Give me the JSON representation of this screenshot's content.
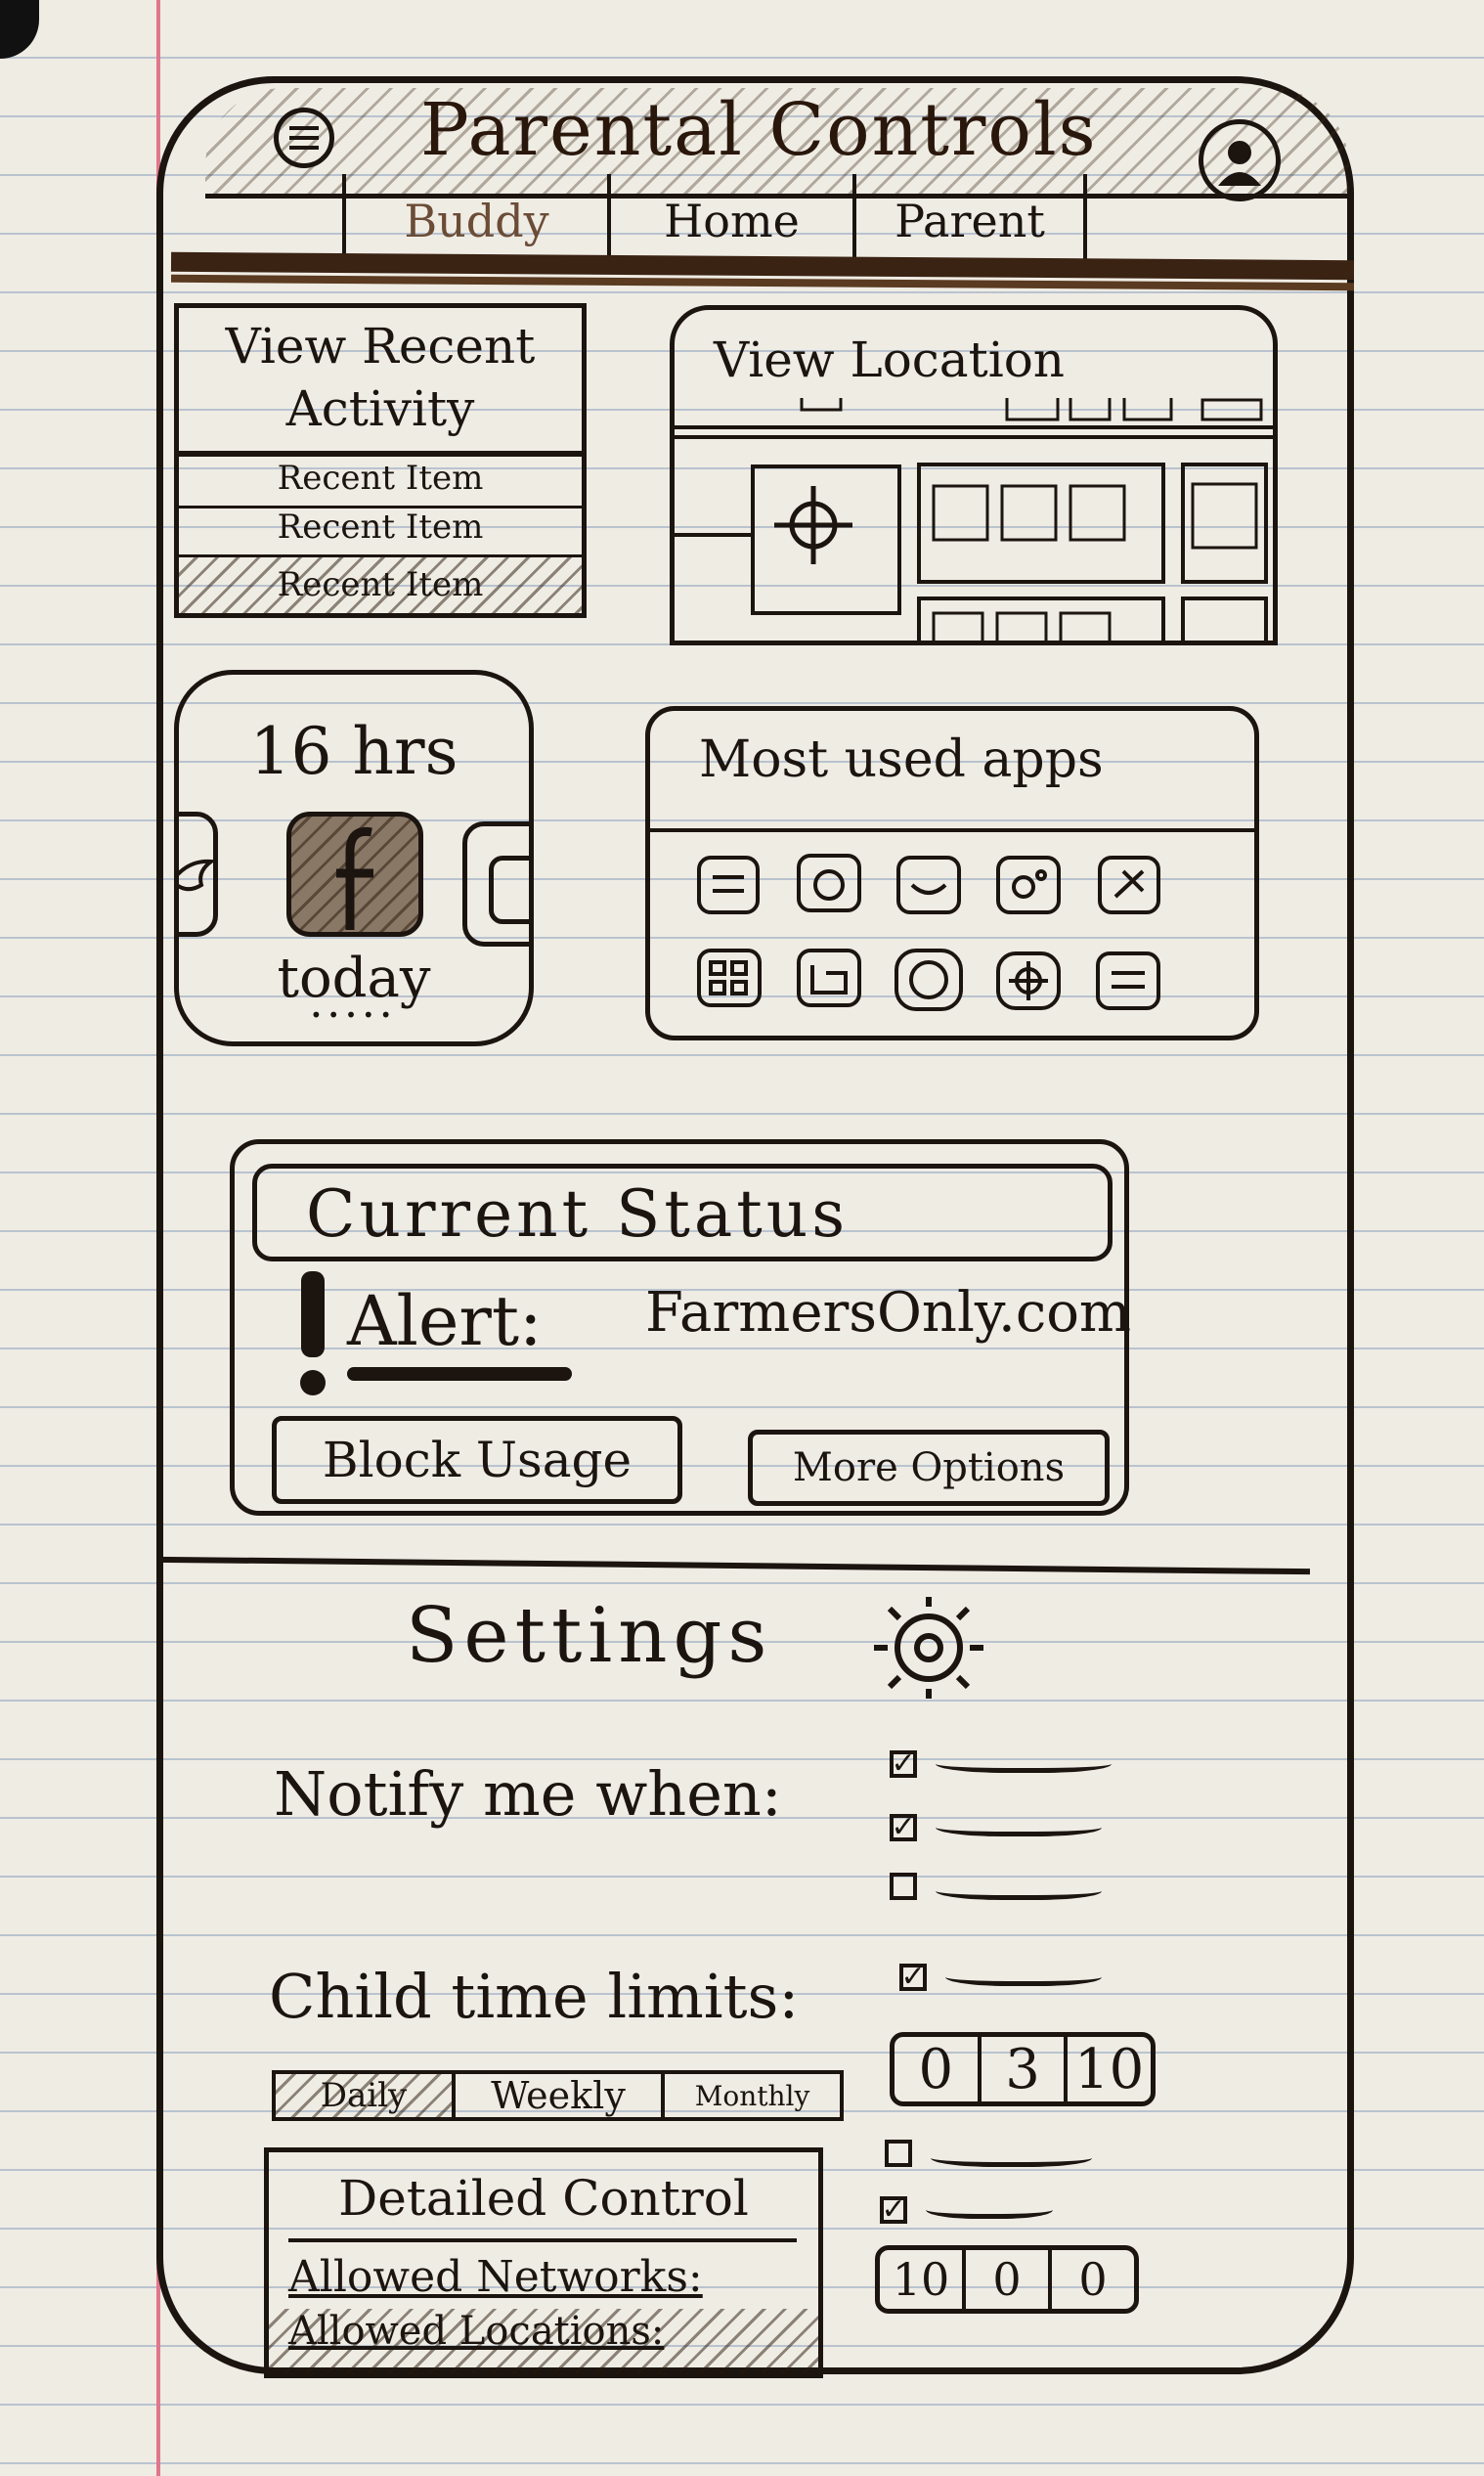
{
  "app": {
    "title": "Parental Controls"
  },
  "tabs": [
    {
      "label": "Buddy"
    },
    {
      "label": "Home"
    },
    {
      "label": "Parent"
    }
  ],
  "recent_activity": {
    "title_line1": "View Recent",
    "title_line2": "Activity",
    "items": [
      "Recent Item",
      "Recent Item",
      "Recent Item"
    ]
  },
  "location": {
    "title": "View Location"
  },
  "usage": {
    "hours": "16 hrs",
    "period": "today",
    "pager": "•••••"
  },
  "most_used": {
    "title": "Most used apps"
  },
  "current_status": {
    "title": "Current Status",
    "alert_label": "Alert:",
    "alert_site": "FarmersOnly.com",
    "block_button": "Block Usage",
    "more_button": "More Options"
  },
  "settings": {
    "title": "Settings",
    "notify_label": "Notify me when:",
    "notify_options": [
      true,
      true,
      false
    ],
    "time_limits_label": "Child time limits:",
    "time_limit_option": true,
    "period_tabs": [
      "Daily",
      "Weekly",
      "Monthly"
    ],
    "time_digits_1": [
      "0",
      "3",
      "10"
    ],
    "extra_options": [
      false,
      true
    ],
    "time_digits_2": [
      "10",
      "0",
      "0"
    ],
    "detailed_control": {
      "title": "Detailed Control",
      "allowed_networks": "Allowed Networks:",
      "allowed_locations": "Allowed Locations:"
    }
  }
}
